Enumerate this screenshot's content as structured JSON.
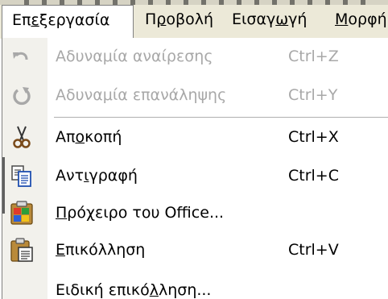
{
  "menubar": {
    "edit": {
      "pre": "Επ",
      "u": "ε",
      "post": "ξεργασία"
    },
    "view": {
      "pre": "Π",
      "u": "ρ",
      "post": "οβολή"
    },
    "insert": {
      "pre": "Εισαγ",
      "u": "ω",
      "post": "γή"
    },
    "format": {
      "pre": "",
      "u": "Μ",
      "post": "ορφή"
    }
  },
  "menu": {
    "undo": {
      "label": "Αδυναμία αναίρεσης",
      "shortcut": "Ctrl+Z",
      "icon": "undo-icon",
      "enabled": false
    },
    "redo": {
      "label": "Αδυναμία επανάληψης",
      "shortcut": "Ctrl+Y",
      "icon": "redo-icon",
      "enabled": false
    },
    "cut": {
      "pre": "Απ",
      "u": "ο",
      "post": "κοπή",
      "shortcut": "Ctrl+X",
      "icon": "scissors-icon"
    },
    "copy": {
      "pre": "Αντ",
      "u": "ι",
      "post": "γραφή",
      "shortcut": "Ctrl+C",
      "icon": "copy-icon"
    },
    "clipboard": {
      "pre": "",
      "u": "Π",
      "post": "ρόχειρο του Office...",
      "icon": "office-clipboard-icon"
    },
    "paste": {
      "pre": "",
      "u": "Ε",
      "post": "πικόλληση",
      "shortcut": "Ctrl+V",
      "icon": "paste-icon"
    },
    "paste_special": {
      "pre": "Ειδική επικό",
      "u": "λ",
      "post": "ληση...",
      "icon": ""
    }
  },
  "colors": {
    "menubar_bg": "#ece9d8",
    "disabled_text": "#a8a8a8",
    "gutter_bg": "#f2f1ec"
  }
}
